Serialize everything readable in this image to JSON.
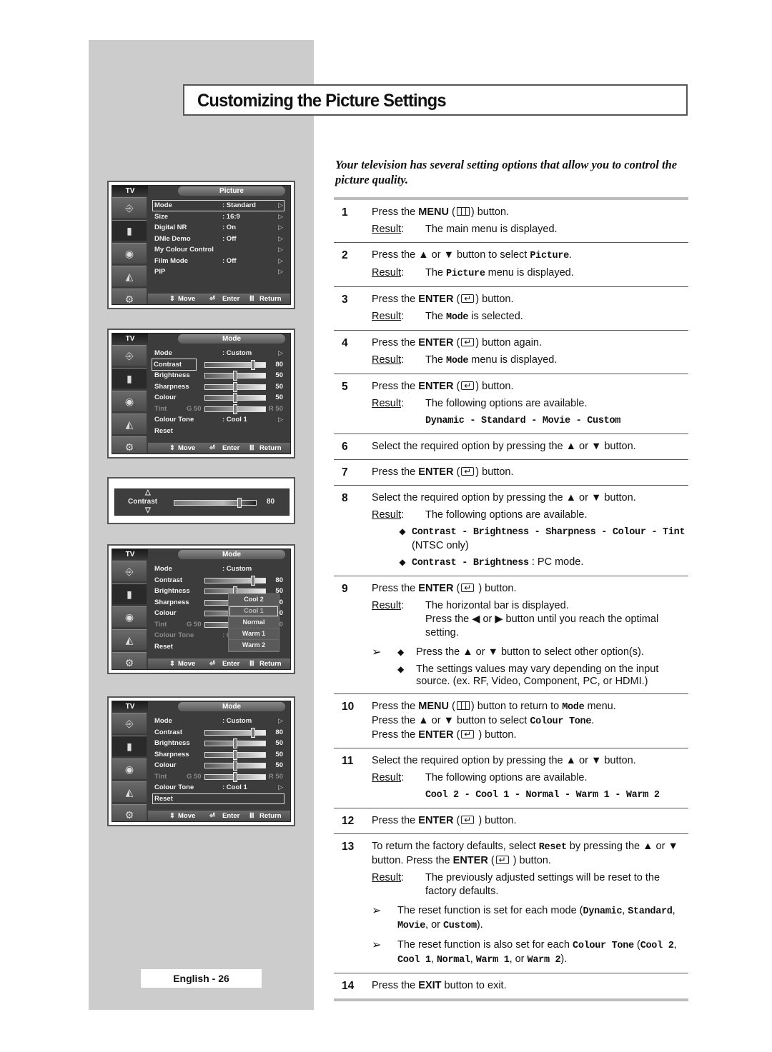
{
  "page": {
    "title": "Customizing the Picture Settings",
    "intro": "Your television has several setting options that allow you to control the picture quality.",
    "page_number": "English - 26"
  },
  "osd_common": {
    "tv_label": "TV",
    "footer_move": "Move",
    "footer_enter": "Enter",
    "footer_return": "Return",
    "sidebar_icons": [
      "input-icon",
      "picture-icon",
      "sound-icon",
      "channel-icon",
      "setup-icon"
    ]
  },
  "osd1": {
    "header": "Picture",
    "rows": [
      {
        "label": "Mode",
        "value": ": Standard",
        "arrow": "▷",
        "selected": true
      },
      {
        "label": "Size",
        "value": ": 16:9",
        "arrow": "▷"
      },
      {
        "label": "Digital NR",
        "value": ": On",
        "arrow": "▷"
      },
      {
        "label": "DNIe Demo",
        "value": ": Off",
        "arrow": "▷"
      },
      {
        "label": "My Colour Control",
        "value": "",
        "arrow": "▷"
      },
      {
        "label": "Film Mode",
        "value": ": Off",
        "arrow": "▷"
      },
      {
        "label": "PIP",
        "value": "",
        "arrow": "▷"
      }
    ]
  },
  "osd_mode": {
    "header": "Mode",
    "mode_label": "Mode",
    "mode_value": ": Custom",
    "contrast_label": "Contrast",
    "contrast_value": "80",
    "brightness_label": "Brightness",
    "brightness_value": "50",
    "sharpness_label": "Sharpness",
    "sharpness_value": "50",
    "colour_label": "Colour",
    "colour_value": "50",
    "tint_label": "Tint",
    "tint_g": "G 50",
    "tint_r": "R 50",
    "tone_label": "Colour Tone",
    "tone_value": ": Cool 1",
    "reset_label": "Reset",
    "arrow": "▷",
    "levels": {
      "contrast": 0.8,
      "brightness": 0.5,
      "sharpness": 0.5,
      "colour": 0.5,
      "tint": 0.5
    }
  },
  "hbar": {
    "label": "Contrast",
    "value": "80",
    "level": 0.8,
    "up": "△",
    "down": "▽"
  },
  "tone_popup": {
    "options": [
      "Cool 2",
      "Cool 1",
      "Normal",
      "Warm 1",
      "Warm 2"
    ],
    "current": "Cool 1"
  },
  "steps": {
    "result_label": "Result",
    "s1": {
      "n": "1",
      "a": "Press the ",
      "b": "MENU",
      "c": " (",
      "d": ") button.",
      "result": "The main menu is displayed."
    },
    "s2": {
      "n": "2",
      "a": "Press the ▲ or ▼ button to select ",
      "code": "Picture",
      "d": ".",
      "result_a": "The ",
      "result_code": "Picture",
      "result_b": " menu is displayed."
    },
    "s3": {
      "n": "3",
      "a": "Press the ",
      "b": "ENTER",
      "c": " (",
      "d": ") button.",
      "result_a": "The ",
      "result_code": "Mode",
      "result_b": " is selected."
    },
    "s4": {
      "n": "4",
      "a": "Press the ",
      "b": "ENTER",
      "c": " (",
      "d": ") button again.",
      "result_a": "The ",
      "result_code": "Mode",
      "result_b": " menu is displayed."
    },
    "s5": {
      "n": "5",
      "a": "Press the ",
      "b": "ENTER",
      "c": " (",
      "d": ") button.",
      "result": "The following options are available.",
      "options": "Dynamic - Standard - Movie - Custom"
    },
    "s6": {
      "n": "6",
      "text": "Select the required option by pressing the ▲ or ▼ button."
    },
    "s7": {
      "n": "7",
      "a": "Press the ",
      "b": "ENTER",
      "c": " (",
      "d": ") button."
    },
    "s8": {
      "n": "8",
      "text": "Select the required option by pressing the ▲ or ▼ button.",
      "result": "The following options are available.",
      "bullet1_code": "Contrast - Brightness - Sharpness - Colour - Tint",
      "bullet1_tail": " (NTSC only)",
      "bullet2_code": "Contrast - Brightness",
      "bullet2_tail": " : PC mode."
    },
    "s9": {
      "n": "9",
      "a": "Press the ",
      "b": "ENTER",
      "c": " (",
      "d": " ) button.",
      "result": "The horizontal bar is displayed.",
      "result2": "Press the ◀ or ▶ button until you reach the optimal setting.",
      "note1": "Press the ▲ or ▼ button to select other option(s).",
      "note2": "The settings values may vary depending on the input source. (ex. RF, Video, Component, PC, or HDMI.)"
    },
    "s10": {
      "n": "10",
      "a": "Press the ",
      "b": "MENU",
      "c": " (",
      "d": ") button to return to ",
      "code": "Mode",
      "e": " menu.",
      "line2_a": "Press the ▲ or ▼ button to select ",
      "line2_code": "Colour Tone",
      "line2_b": ".",
      "line3_a": "Press the ",
      "line3_b": "ENTER",
      "line3_c": " (",
      "line3_d": " ) button."
    },
    "s11": {
      "n": "11",
      "text": "Select the required option by pressing the ▲ or ▼ button.",
      "result": "The following options are available.",
      "options": "Cool 2 - Cool 1 - Normal - Warm 1 - Warm 2"
    },
    "s12": {
      "n": "12",
      "a": "Press the ",
      "b": "ENTER",
      "c": " (",
      "d": " ) button."
    },
    "s13": {
      "n": "13",
      "a": "To return the factory defaults, select ",
      "code": "Reset",
      "b": " by pressing the ▲ or ▼ button. Press the ",
      "c": "ENTER",
      "d": " (",
      "e": " ) button.",
      "result": "The previously adjusted settings will be reset to the factory defaults.",
      "note1_a": "The reset function is set for each mode (",
      "note1_c1": "Dynamic",
      "note1_s1": ", ",
      "note1_c2": "Standard",
      "note1_s2": ", ",
      "note1_c3": "Movie",
      "note1_s3": ", or ",
      "note1_c4": "Custom",
      "note1_e": ").",
      "note2_a": "The reset function is also set for each ",
      "note2_c0": "Colour Tone",
      "note2_s0": " (",
      "note2_c1": "Cool 2",
      "note2_s1": ", ",
      "note2_c2": "Cool 1",
      "note2_s2": ", ",
      "note2_c3": "Normal",
      "note2_s3": ", ",
      "note2_c4": "Warm 1",
      "note2_s4": ", or ",
      "note2_c5": "Warm 2",
      "note2_e": ")."
    },
    "s14": {
      "n": "14",
      "a": "Press the ",
      "b": "EXIT",
      "c": " button to exit."
    },
    "bullet": "◆",
    "note_arrow": "➢"
  }
}
